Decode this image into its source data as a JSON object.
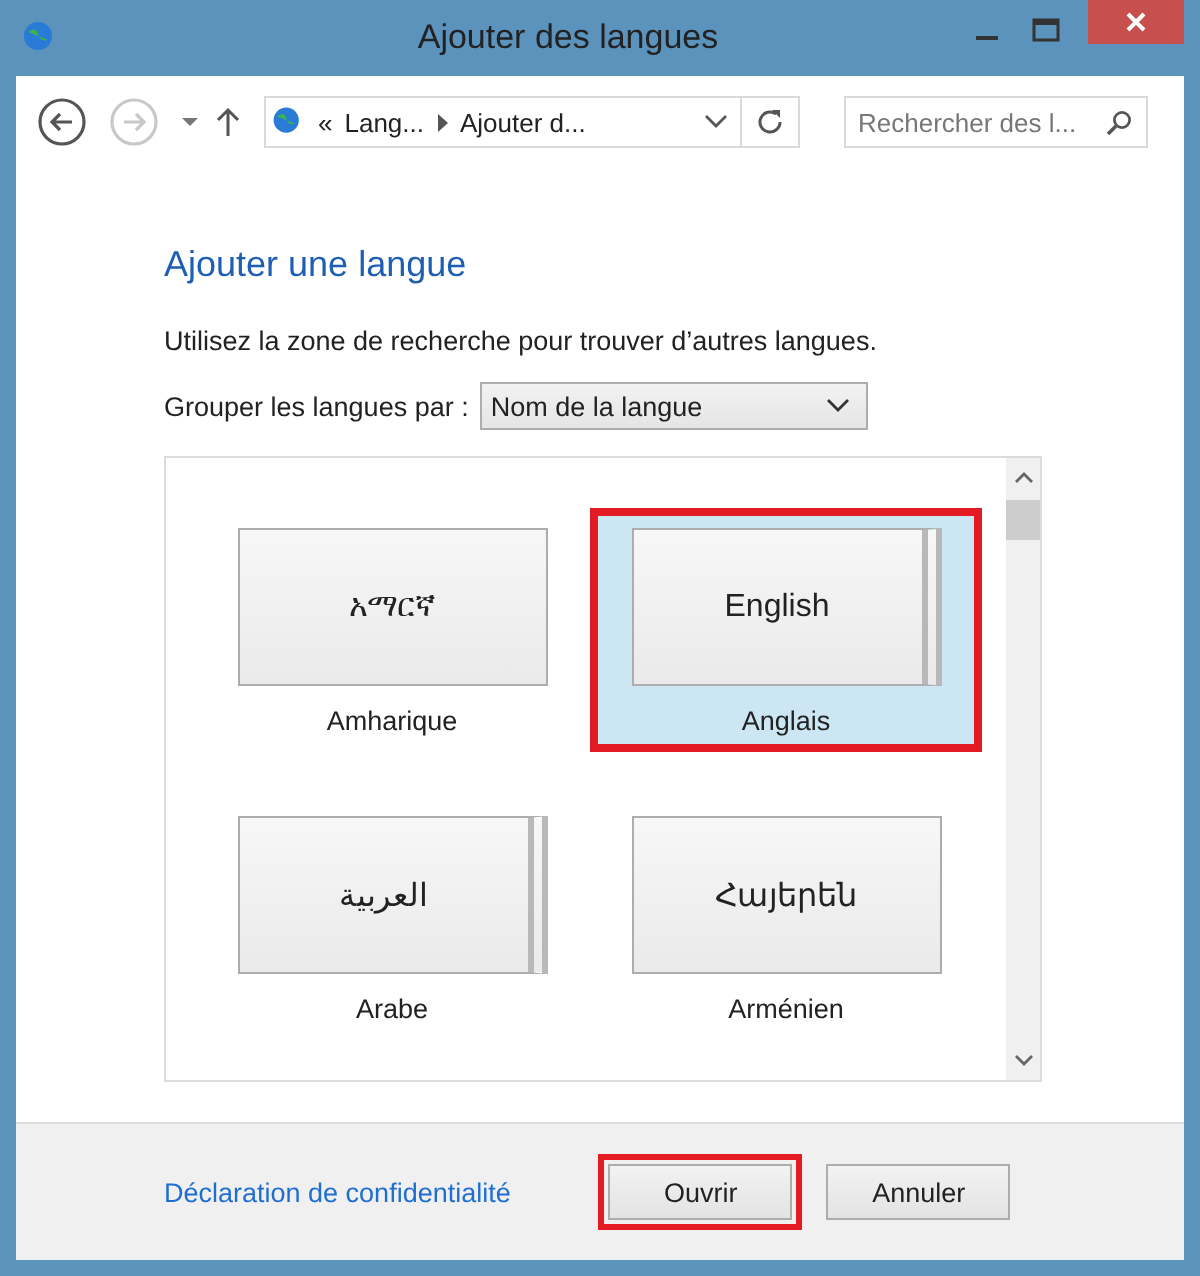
{
  "window": {
    "title": "Ajouter des langues"
  },
  "address_bar": {
    "crumbs": [
      "«",
      "Lang...",
      "Ajouter d..."
    ]
  },
  "search": {
    "placeholder": "Rechercher des l..."
  },
  "heading": "Ajouter une langue",
  "instruction": "Utilisez la zone de recherche pour trouver d’autres langues.",
  "group_by": {
    "label": "Grouper les langues par :",
    "value": "Nom de la langue"
  },
  "languages": [
    {
      "native": "አማርኛ",
      "name": "Amharique",
      "selected": false,
      "variants": false,
      "highlighted": false
    },
    {
      "native": "English",
      "name": "Anglais",
      "selected": true,
      "variants": true,
      "highlighted": true
    },
    {
      "native": "العربية",
      "name": "Arabe",
      "selected": false,
      "variants": true,
      "highlighted": false
    },
    {
      "native": "Հայերեն",
      "name": "Arménien",
      "selected": false,
      "variants": false,
      "highlighted": false
    }
  ],
  "privacy_link": "Déclaration de confidentialité",
  "buttons": [
    {
      "label": "Ouvrir",
      "highlighted": true
    },
    {
      "label": "Annuler",
      "highlighted": false
    }
  ]
}
